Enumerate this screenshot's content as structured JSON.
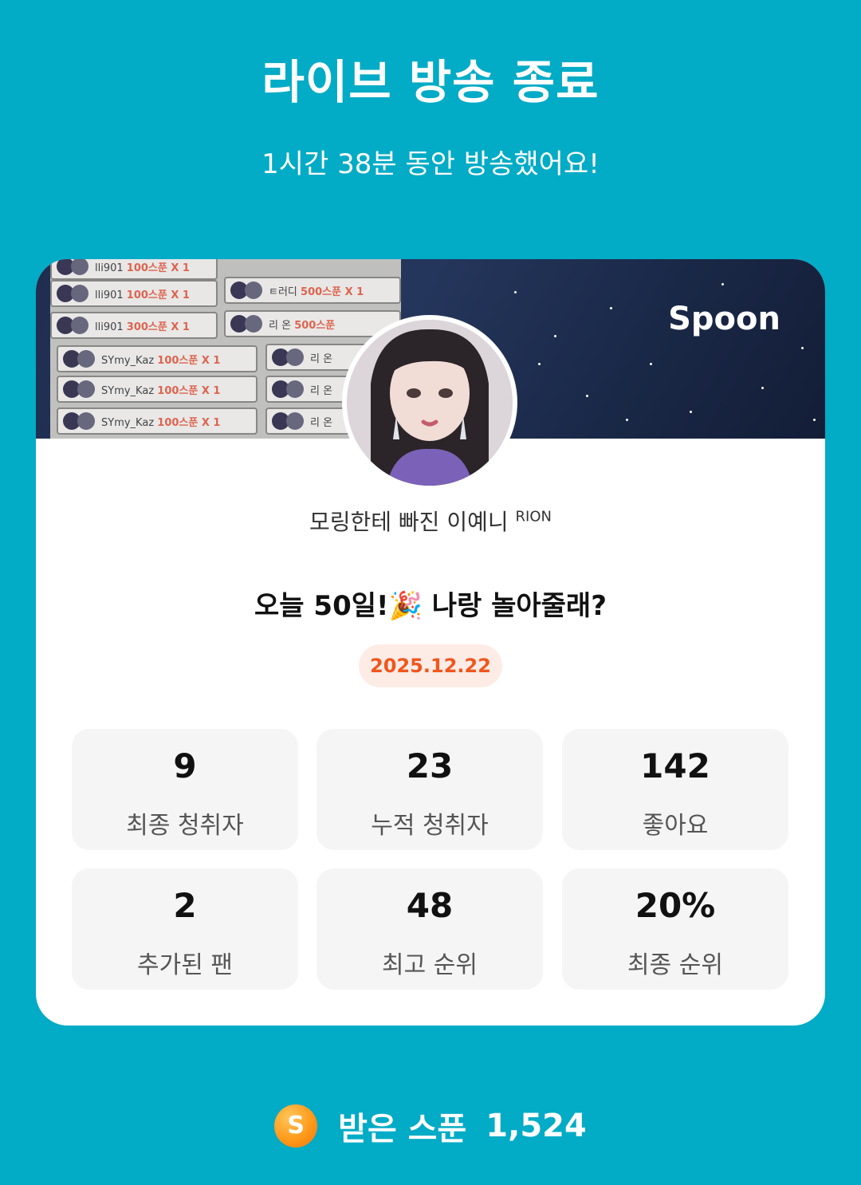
{
  "header": {
    "title": "라이브 방송 종료",
    "subtitle": "1시간 38분 동안 방송했어요!"
  },
  "banner": {
    "brand": "Spoon",
    "gift_rows": [
      {
        "user": "lli901",
        "gift": "100스푼 X 1"
      },
      {
        "user": "lli901",
        "gift": "100스푼 X 1"
      },
      {
        "user": "lli901",
        "gift": "300스푼 X 1"
      },
      {
        "user": "SYmy_Kaz",
        "gift": "100스푼 X 1"
      },
      {
        "user": "SYmy_Kaz",
        "gift": "100스푼 X 1"
      },
      {
        "user": "SYmy_Kaz",
        "gift": "100스푼 X 1"
      },
      {
        "user": "ㅌ러디",
        "gift": "500스푼 X 1"
      },
      {
        "user": "리 온",
        "gift": "500스푼"
      },
      {
        "user": "리 온",
        "gift": ""
      },
      {
        "user": "리 온",
        "gift": ""
      },
      {
        "user": "리 온",
        "gift": ""
      }
    ]
  },
  "profile": {
    "nickname": "모링한테 빠진 이예니",
    "nickname_tag": "RION"
  },
  "live": {
    "title": "오늘 50일!🎉 나랑 놀아줄래?",
    "date": "2025.12.22"
  },
  "stats": [
    {
      "value": "9",
      "label": "최종 청취자"
    },
    {
      "value": "23",
      "label": "누적 청취자"
    },
    {
      "value": "142",
      "label": "좋아요"
    },
    {
      "value": "2",
      "label": "추가된 팬"
    },
    {
      "value": "48",
      "label": "최고 순위"
    },
    {
      "value": "20%",
      "label": "최종 순위"
    }
  ],
  "footer": {
    "coin_letter": "S",
    "label": "받은 스푼",
    "count": "1,524"
  },
  "colors": {
    "background": "#02abc6",
    "date_text": "#f0561d",
    "date_bg": "#fdece6",
    "stat_bg": "#f5f5f5"
  }
}
